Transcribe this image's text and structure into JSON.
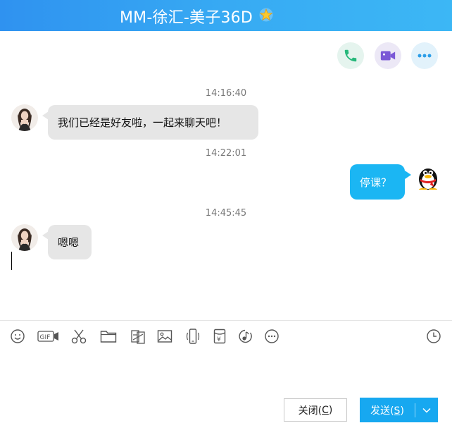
{
  "window": {
    "title": "MM-徐汇-美子36D",
    "star_badge": "star-badge-icon"
  },
  "actions": {
    "voice_call": "phone-icon",
    "video_call": "video-camera-icon",
    "more": "more-icon"
  },
  "messages": [
    {
      "time": "14:16:40",
      "direction": "in",
      "text": "我们已经是好友啦，一起来聊天吧！"
    },
    {
      "time": "14:22:01",
      "direction": "out",
      "text": "停课？"
    },
    {
      "time": "14:45:45",
      "direction": "in",
      "text": "嗯嗯"
    }
  ],
  "toolbar": {
    "gif_label": "GIF",
    "currency_label": "¥",
    "items": [
      "emoji-icon",
      "gif-icon",
      "scissors-icon",
      "folder-icon",
      "image-edit-icon",
      "picture-icon",
      "shake-icon",
      "red-packet-icon",
      "music-icon",
      "more-icon",
      "history-clock-icon"
    ]
  },
  "buttons": {
    "close_prefix": "关闭(",
    "close_key": "C",
    "close_suffix": ")",
    "send_prefix": "发送(",
    "send_key": "S",
    "send_suffix": ")"
  },
  "colors": {
    "titlebar": "#37aaf3",
    "outgoing_bubble": "#1bb6f3",
    "incoming_bubble": "#e6e6e6",
    "send_button": "#17a8f0"
  }
}
